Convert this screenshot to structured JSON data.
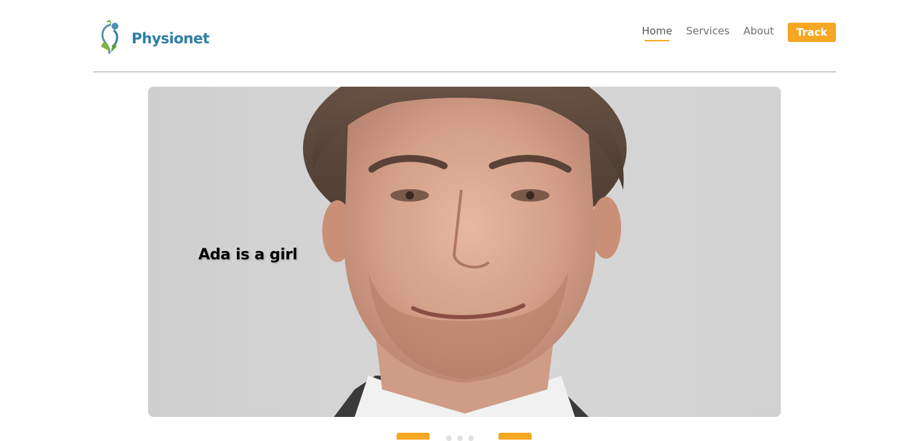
{
  "brand": {
    "name": "Physionet",
    "logo_icon": "physionet-logo-icon"
  },
  "nav": {
    "items": [
      {
        "label": "Home",
        "active": true
      },
      {
        "label": "Services",
        "active": false
      },
      {
        "label": "About",
        "active": false
      }
    ],
    "cta_label": "Track"
  },
  "hero": {
    "caption": "Ada is a girl",
    "image_icon": "portrait-photo"
  },
  "carousel": {
    "prev_icon": "chevron-left-icon",
    "next_icon": "chevron-right-icon",
    "dot_count": 3
  },
  "colors": {
    "accent": "#f5a623",
    "brand": "#2f7fa3",
    "divider": "#9e9e9e"
  }
}
